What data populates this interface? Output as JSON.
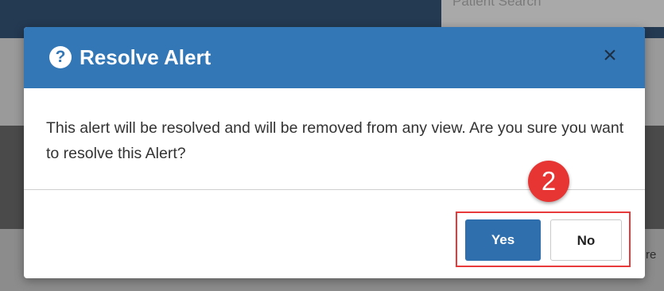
{
  "background": {
    "search_label": "Patient Search",
    "edge_text": "re"
  },
  "dialog": {
    "title": "Resolve Alert",
    "help_icon": "?",
    "close_icon": "×",
    "message": "This alert will be resolved and will be removed from any view. Are you sure you want to resolve this Alert?",
    "buttons": {
      "yes_label": "Yes",
      "no_label": "No"
    }
  },
  "annotation": {
    "step_number": "2",
    "color": "#e73533"
  },
  "colors": {
    "header": "#3377b7",
    "primary_button": "#2f6fad"
  }
}
